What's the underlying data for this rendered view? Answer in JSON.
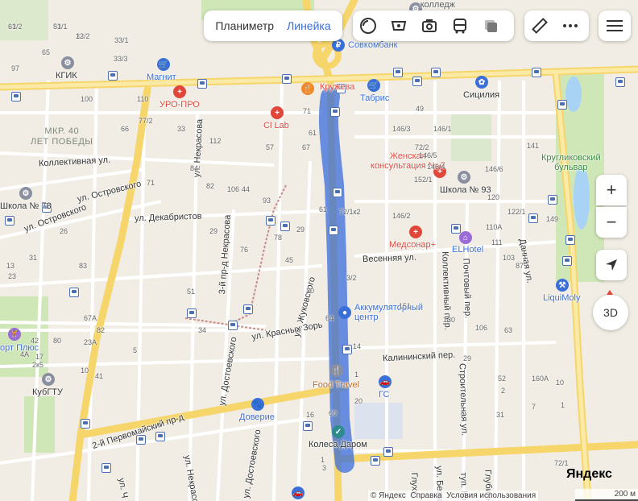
{
  "toolbar": {
    "planimeter": "Планиметр",
    "ruler": "Линейка",
    "icons": [
      "layers-icon",
      "panorama-icon",
      "camera-icon",
      "transit-icon",
      "traffic-icon",
      "measure-icon",
      "more-icon",
      "menu-icon"
    ]
  },
  "controls": {
    "zoom_in": "+",
    "zoom_out": "−",
    "view3d": "3D"
  },
  "district": "МКР. 40\nЛЕТ ПОБЕДЫ",
  "streets": {
    "kollektivnaya": "Коллективная ул.",
    "ostrovskogo1": "ул. Островского",
    "ostrovskogo2": "ул. Островского",
    "dekabristov": "ул. Декабристов",
    "nekrasova": "ул. Некрасова",
    "nekrasova_pr": "3-й пр-д Некрасова",
    "zhukovskogo": "ул. Жуковского",
    "krasnyh_zor": "ул. Красных Зорь",
    "dostoevskogo": "ул. Достоевского",
    "dostoevskogo2": "ул. Достоевского",
    "vesennyaya": "Весенняя ул.",
    "kollektivny_per": "Коллективный пер.",
    "pochtovy_per": "Почтовый пер.",
    "kalininsky_per": "Калининский пер.",
    "stroitelnaya": "Строительная ул.",
    "dannaya": "Данная ул.",
    "pervomaysky": "2-й Первомайский пр-д",
    "kruglikovsky": "Кругликовский\nбульвар",
    "nekrasova_bottom": "ул. Некрасова",
    "glubinny": "Глубин",
    "bezym": "ул. Безым",
    "tup_kr": "туп. Кр",
    "glubinny2": "Глубинн",
    "gluho": "Глухо",
    "ch": "ул. Ч"
  },
  "pois": {
    "kgik": "КГИК",
    "magnit": "Магнит",
    "uro_pro": "УРО-ПРО",
    "cl_lab": "Cl Lab",
    "sovkombank": "Совкомбанк",
    "kruzheva": "Кружева",
    "tabris": "Табрис",
    "sicilia": "Сицилия",
    "zhenskaya": "Женская\nконсультация № 7",
    "shkola93": "Школа № 93",
    "shkola78": "Школа № 78",
    "medsonar": "Медсонар+",
    "elhotel": "ELHotel",
    "liquimoly": "LiquiMoly",
    "akkum": "Аккумуляторный\nцентр",
    "food_travel": "Food Travel",
    "gs": "ГС",
    "doverie": "Доверие",
    "kolesa": "Колеса Даром",
    "kubgtu": "КубГТУ",
    "sport": "орт Плюс",
    "college": "Технологический\nколледж"
  },
  "houses": [
    "33/2",
    "33/1",
    "33/2",
    "33/3",
    "33/1",
    "65",
    "97",
    "110",
    "77/2",
    "33",
    "100",
    "66",
    "112",
    "71",
    "61",
    "67",
    "57",
    "84",
    "71",
    "82",
    "44",
    "106",
    "93",
    "61",
    "72/1к2",
    "78",
    "29",
    "29",
    "76",
    "45",
    "20",
    "83",
    "51",
    "64",
    "41",
    "20",
    "16",
    "60",
    "1",
    "3",
    "31",
    "13",
    "23",
    "26",
    "17",
    "10",
    "49",
    "146/1",
    "146/3",
    "146/2",
    "72/2",
    "146/5",
    "146/4",
    "146/6",
    "152/1",
    "120",
    "141",
    "122/1",
    "110А",
    "111",
    "103",
    "87",
    "149",
    "151",
    "130",
    "106",
    "63",
    "67А",
    "82",
    "4А",
    "2к5",
    "23А",
    "5",
    "34",
    "42",
    "80",
    "14",
    "1",
    "3/2",
    "72/1",
    "52",
    "160А",
    "10",
    "31",
    "2",
    "1",
    "7",
    "29",
    "61",
    "51",
    "12"
  ],
  "attribution": {
    "copyright": "© Яндекс",
    "help": "Справка",
    "terms": "Условия использования",
    "scale": "200 м",
    "logo": "Яндекс"
  },
  "colors": {
    "route": "#3a6cdc",
    "main_road": "#f6d66a",
    "water": "#a9d3f5",
    "park": "#cfe6b7",
    "accent": "#3a6fd8",
    "yandex_red": "#ff0000"
  }
}
